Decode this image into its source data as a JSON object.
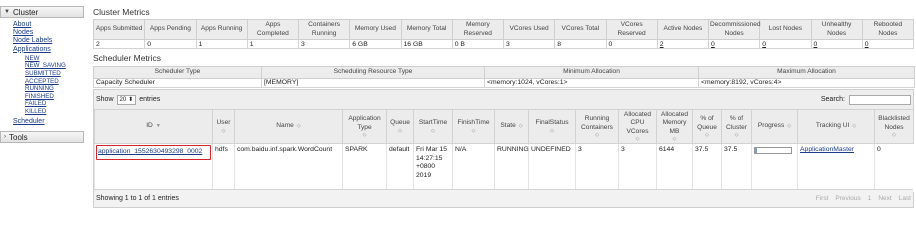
{
  "sidebar": {
    "cluster_title": "Cluster",
    "links": [
      "About",
      "Nodes",
      "Node Labels",
      "Applications"
    ],
    "app_states": [
      "NEW",
      "NEW_SAVING",
      "SUBMITTED",
      "ACCEPTED",
      "RUNNING",
      "FINISHED",
      "FAILED",
      "KILLED"
    ],
    "scheduler": "Scheduler",
    "tools_title": "Tools"
  },
  "metrics": {
    "title": "Cluster Metrics",
    "headers": [
      "Apps Submitted",
      "Apps Pending",
      "Apps Running",
      "Apps Completed",
      "Containers Running",
      "Memory Used",
      "Memory Total",
      "Memory Reserved",
      "VCores Used",
      "VCores Total",
      "VCores Reserved",
      "Active Nodes",
      "Decommissioned Nodes",
      "Lost Nodes",
      "Unhealthy Nodes",
      "Rebooted Nodes"
    ],
    "values": [
      "2",
      "0",
      "1",
      "1",
      "3",
      "6 GB",
      "16 GB",
      "0 B",
      "3",
      "8",
      "0",
      "2",
      "0",
      "0",
      "0",
      "0"
    ]
  },
  "scheduler_metrics": {
    "title": "Scheduler Metrics",
    "headers": [
      "Scheduler Type",
      "Scheduling Resource Type",
      "Minimum Allocation",
      "Maximum Allocation"
    ],
    "values": [
      "Capacity Scheduler",
      "[MEMORY]",
      "<memory:1024, vCores:1>",
      "<memory:8192, vCores:4>"
    ]
  },
  "apps": {
    "show_label": "Show",
    "entries_value": "20",
    "entries_label": "entries",
    "search_label": "Search:",
    "headers": [
      "ID",
      "User",
      "Name",
      "Application Type",
      "Queue",
      "StartTime",
      "FinishTime",
      "State",
      "FinalStatus",
      "Running Containers",
      "Allocated CPU VCores",
      "Allocated Memory MB",
      "% of Queue",
      "% of Cluster",
      "Progress",
      "Tracking UI",
      "Blacklisted Nodes"
    ],
    "row": {
      "id": "application_1552630493298_0002",
      "user": "hdfs",
      "name": "com.baidu.inf.spark.WordCount",
      "type": "SPARK",
      "queue": "default",
      "start_time": "Fri Mar 15 14:27:15 +0800 2019",
      "finish_time": "N/A",
      "state": "RUNNING",
      "final_status": "UNDEFINED",
      "running_containers": "3",
      "vcores": "3",
      "memory_mb": "6144",
      "pct_queue": "37.5",
      "pct_cluster": "37.5",
      "progress": 0.05,
      "tracking_ui": "ApplicationMaster",
      "blacklisted": "0"
    },
    "footer_info": "Showing 1 to 1 of 1 entries",
    "pager": [
      "First",
      "Previous",
      "1",
      "Next",
      "Last"
    ]
  },
  "colors": {
    "link": "#1b3a8a",
    "highlight": "#d2262b"
  }
}
